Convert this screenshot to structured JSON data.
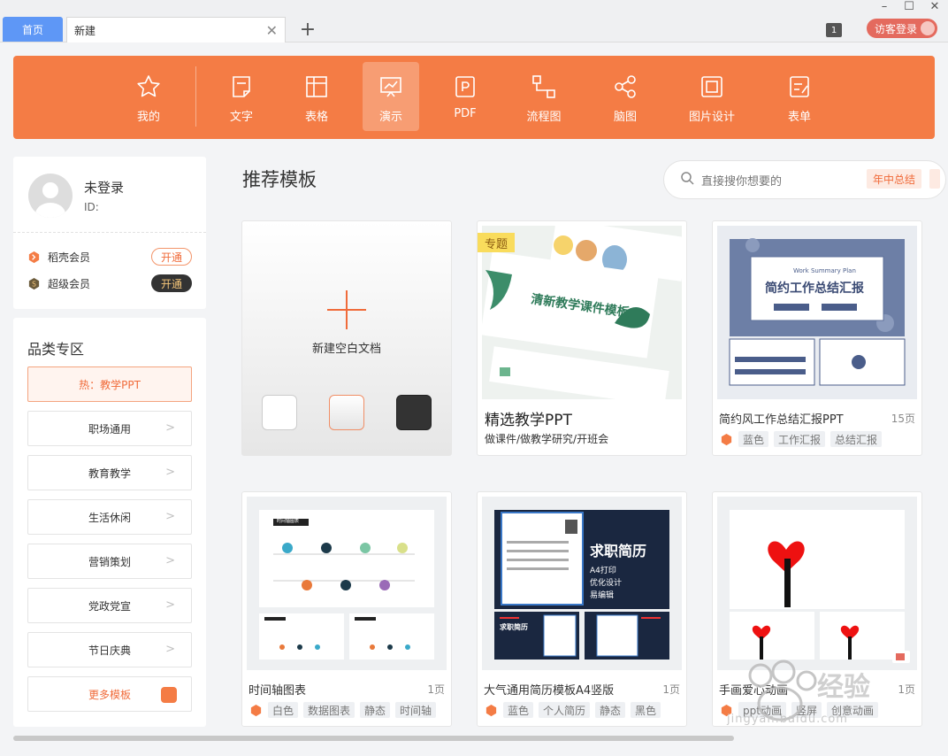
{
  "titlebar": {
    "home_tab": "首页",
    "new_tab": "新建",
    "close": "✕",
    "add": "+",
    "minimize": "–",
    "maximize": "☐",
    "close_window": "✕",
    "badge": "1",
    "login": "访客登录"
  },
  "categories": [
    {
      "label": "我的",
      "icon": "star-icon"
    },
    {
      "label": "文字",
      "icon": "document-icon"
    },
    {
      "label": "表格",
      "icon": "table-icon"
    },
    {
      "label": "演示",
      "icon": "presentation-icon",
      "active": true
    },
    {
      "label": "PDF",
      "icon": "pdf-icon"
    },
    {
      "label": "流程图",
      "icon": "flowchart-icon"
    },
    {
      "label": "脑图",
      "icon": "mindmap-icon"
    },
    {
      "label": "图片设计",
      "icon": "image-design-icon"
    },
    {
      "label": "表单",
      "icon": "form-icon"
    }
  ],
  "user": {
    "name": "未登录",
    "id_label": "ID:",
    "members": [
      {
        "label": "稻壳会员",
        "button": "开通"
      },
      {
        "label": "超级会员",
        "button": "开通"
      }
    ]
  },
  "sidebar": {
    "title": "品类专区",
    "items": [
      {
        "label": "热：教学PPT"
      },
      {
        "label": "职场通用"
      },
      {
        "label": "教育教学"
      },
      {
        "label": "生活休闲"
      },
      {
        "label": "营销策划"
      },
      {
        "label": "党政党宣"
      },
      {
        "label": "节日庆典"
      },
      {
        "label": "更多模板"
      }
    ]
  },
  "main": {
    "title": "推荐模板",
    "search_placeholder": "直接搜你想要的",
    "search_tag": "年中总结",
    "new_blank": "新建空白文档",
    "featured": {
      "badge": "专题",
      "thumb_title": "清新教学课件模板",
      "title": "精选教学PPT",
      "subtitle": "做课件/做教学研究/开班会"
    },
    "cards": [
      {
        "title": "简约风工作总结汇报PPT",
        "pages": "15页",
        "tags": [
          "蓝色",
          "工作汇报",
          "总结汇报"
        ],
        "thumb_title": "简约工作总结汇报",
        "thumb_en": "Work Summary Plan"
      },
      {
        "title": "时间轴图表",
        "pages": "1页",
        "tags": [
          "白色",
          "数据图表",
          "静态",
          "时间轴"
        ],
        "thumb_title": "时间轴图表"
      },
      {
        "title": "大气通用简历模板A4竖版",
        "pages": "1页",
        "tags": [
          "蓝色",
          "个人简历",
          "静态",
          "黑色"
        ],
        "thumb_title": "求职简历",
        "thumb_lines": [
          "A4打印",
          "优化设计",
          "易编辑"
        ],
        "thumb_small": "求职简历"
      },
      {
        "title": "手画爱心动画",
        "pages": "1页",
        "tags": [
          "ppt动画",
          "竖屏",
          "创意动画"
        ]
      }
    ]
  },
  "watermark": {
    "text": "经验",
    "url": "jingyan.baidu.com"
  },
  "colors": {
    "accent": "#f47c45",
    "home_tab": "#5e97f6",
    "login": "#e46a5e"
  }
}
